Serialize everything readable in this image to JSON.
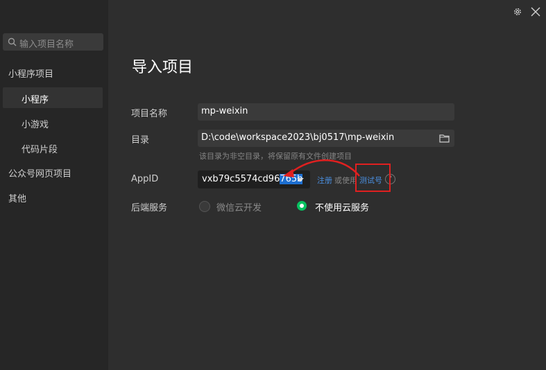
{
  "sidebar": {
    "search_placeholder": "输入项目名称",
    "items": [
      {
        "label": "小程序项目"
      },
      {
        "label": "小程序"
      },
      {
        "label": "小游戏"
      },
      {
        "label": "代码片段"
      },
      {
        "label": "公众号网页项目"
      },
      {
        "label": "其他"
      }
    ]
  },
  "page": {
    "title": "导入项目"
  },
  "form": {
    "project_name_label": "项目名称",
    "project_name_value": "mp-weixin",
    "directory_label": "目录",
    "directory_value": "D:\\code\\workspace2023\\bj0517\\mp-weixin",
    "directory_hint": "该目录为非空目录，将保留原有文件创建项目",
    "appid_label": "AppID",
    "appid_value_prefix": "vxb79c5574cd96",
    "appid_value_selected": "765b",
    "register_link": "注册",
    "or_use": "或使用",
    "test_account_link": "测试号",
    "help_symbol": "?",
    "backend_label": "后端服务",
    "backend_options": [
      {
        "label": "微信云开发",
        "selected": false
      },
      {
        "label": "不使用云服务",
        "selected": true
      }
    ]
  },
  "icons": {
    "settings": "gear-icon",
    "close": "close-icon",
    "search": "search-icon",
    "folder": "folder-icon"
  },
  "colors": {
    "accent_green": "#07c160",
    "link_blue": "#4a90e2",
    "selection_blue": "#1d6fd1",
    "annotation_red": "#e02020"
  }
}
